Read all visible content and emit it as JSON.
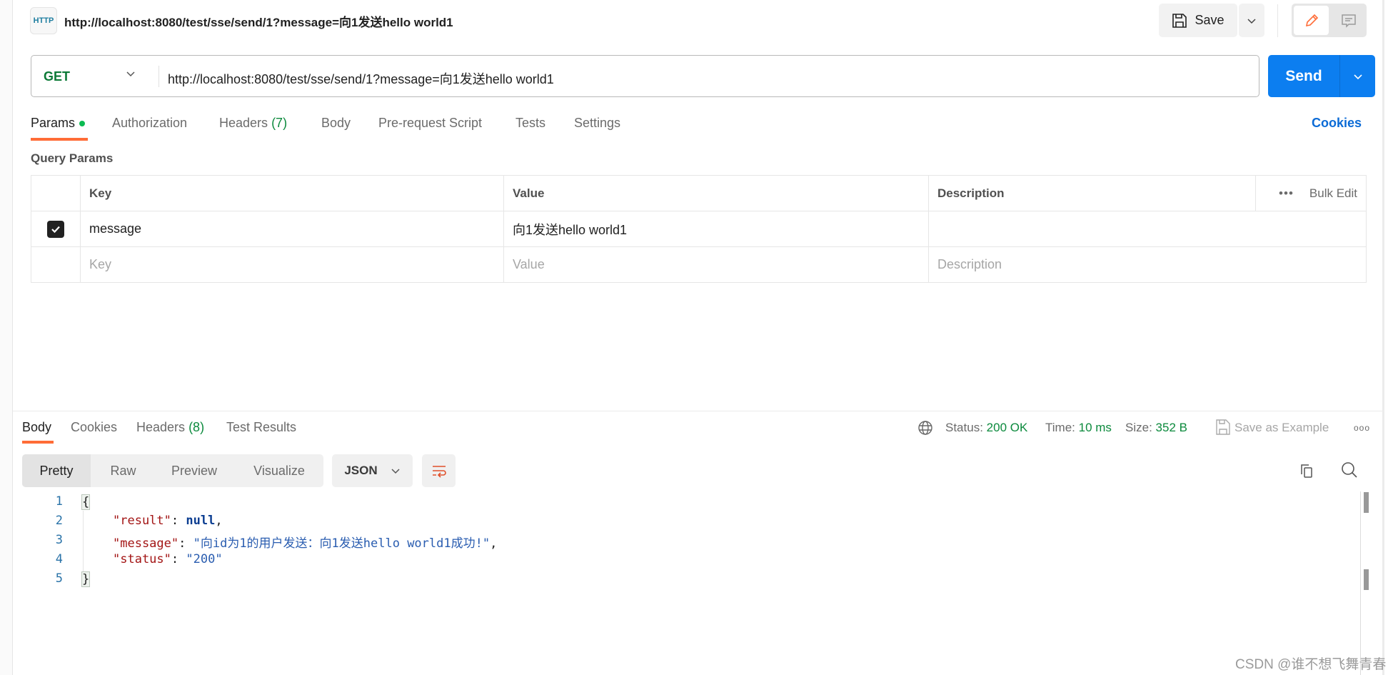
{
  "header": {
    "icon_label": "HTTP",
    "title": "http://localhost:8080/test/sse/send/1?message=向1发送hello world1",
    "save_label": "Save"
  },
  "request": {
    "method": "GET",
    "url": "http://localhost:8080/test/sse/send/1?message=向1发送hello world1",
    "send_label": "Send"
  },
  "tabs": [
    {
      "label": "Params"
    },
    {
      "label": "Authorization"
    },
    {
      "label": "Headers",
      "count": "(7)"
    },
    {
      "label": "Body"
    },
    {
      "label": "Pre-request Script"
    },
    {
      "label": "Tests"
    },
    {
      "label": "Settings"
    }
  ],
  "cookies_link": "Cookies",
  "query_params": {
    "title": "Query Params",
    "headers": [
      "Key",
      "Value",
      "Description"
    ],
    "bulk_edit": "Bulk Edit",
    "rows": [
      {
        "checked": true,
        "key": "message",
        "value": "向1发送hello world1",
        "description": ""
      }
    ],
    "placeholders": {
      "key": "Key",
      "value": "Value",
      "description": "Description"
    }
  },
  "response": {
    "tabs": [
      {
        "label": "Body"
      },
      {
        "label": "Cookies"
      },
      {
        "label": "Headers",
        "count": "(8)"
      },
      {
        "label": "Test Results"
      }
    ],
    "status_label": "Status:",
    "status": "200 OK",
    "time_label": "Time:",
    "time": "10 ms",
    "size_label": "Size:",
    "size": "352 B",
    "save_example": "Save as Example",
    "views": [
      "Pretty",
      "Raw",
      "Preview",
      "Visualize"
    ],
    "format": "JSON",
    "lines": [
      "1",
      "2",
      "3",
      "4",
      "5"
    ],
    "json": {
      "open": "{",
      "close": "}",
      "k1": "\"result\"",
      "v1": "null",
      "k2": "\"message\"",
      "v2": "\"向id为1的用户发送：向1发送hello world1成功!\"",
      "k3": "\"status\"",
      "v3": "\"200\""
    }
  },
  "watermark": "CSDN @谁不想飞舞青春",
  "colors": {
    "accent": "#ff6c37",
    "send": "#0c7ef0",
    "success": "#0c8a3d"
  }
}
